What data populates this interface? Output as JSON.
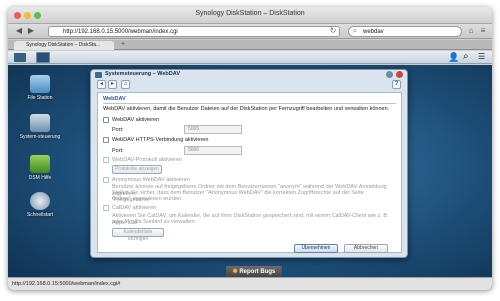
{
  "window": {
    "title": "Synology DiskStation – DiskStation"
  },
  "browser": {
    "url": "http://192.168.0.15:5000/webman/index.cgi",
    "search_value": "webdav",
    "tab_label": "Synology DiskStation – DiskSta...",
    "new_tab_symbol": "+",
    "status_url": "http://192.168.0.15:5000/webman/index.cgi#"
  },
  "desktop": {
    "icons": [
      {
        "label": "File Station"
      },
      {
        "label": "System-steuerung"
      },
      {
        "label": "DSM Hilfe"
      },
      {
        "label": "Schnellstart"
      }
    ]
  },
  "dialog": {
    "title": "Systemsteuerung – WebDAV",
    "help_symbol": "?",
    "section_title": "WebDAV",
    "description": "WebDAV aktivieren, damit die Benutzer Dateien auf der DiskStation per Fernzugriff bearbeiten und verwalten können.",
    "webdav_enable_label": "WebDAV aktivieren",
    "port_label": "Port:",
    "webdav_port": "5005",
    "https_enable_label": "WebDAV HTTPS-Verbindung aktivieren",
    "https_port": "5006",
    "log_enable_label": "WebDAV-Protokoll aktivieren",
    "show_logs_button": "Protokolle anzeigen",
    "anonymous_label": "Anonymous WebDAV aktivieren",
    "anonymous_desc_1": "Benutzer können auf freigegebene Ordner mit dem Benutzernamen \"anonym\" während der WebDAV-Anmeldung zugreifen.",
    "anonymous_desc_2": "Stellen Sie sicher, dass dem Benutzer \"Anonymous WebDAV\" die korrekten Zugriffsrechte auf der Seite \"Freigegebener",
    "anonymous_desc_3": "Ordner\" zugewiesen wurden.",
    "caldav_label": "CalDAV aktivieren",
    "caldav_desc_1": "Aktivieren Sie CalDAV, um Kalender, die auf Ihrer DiskStation gespeichert sind, mit einem CalDAV-Client wie z. B. Apple iCal",
    "caldav_desc_2": "oder Mozilla Sunbird zu verwalten.",
    "show_calendars_button": "Kalenderliste anzeigen",
    "ok_button": "Übernehmen",
    "cancel_button": "Abbrechen"
  },
  "report_bugs": "Report Bugs",
  "colors": {
    "accent": "#2b5a8c",
    "desktop_bg": "#1d4e78"
  }
}
